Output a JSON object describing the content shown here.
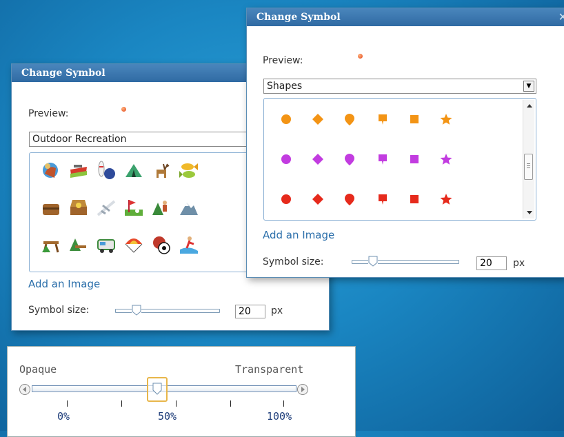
{
  "dialog_back": {
    "title": "Change Symbol",
    "preview_label": "Preview:",
    "category": "Outdoor Recreation",
    "icons": [
      "horse-rider-icon",
      "boat-icon",
      "bowling-icon",
      "tent-icon",
      "deer-icon",
      "fish-icon",
      "treasure-chest-icon",
      "open-chest-icon",
      "airplane-icon",
      "golf-icon",
      "hiker-icon",
      "mountain-icon",
      "picnic-table-icon",
      "campsite-icon",
      "rv-icon",
      "parachute-icon",
      "sports-balls-icon",
      "water-skier-icon"
    ],
    "add_image": "Add an Image",
    "size_label": "Symbol size:",
    "size_value": "20",
    "size_unit": "px"
  },
  "dialog_front": {
    "title": "Change Symbol",
    "preview_label": "Preview:",
    "category": "Shapes",
    "dropdown_arrow": "▼",
    "shape_rows": [
      {
        "color": "#f39415",
        "shapes": [
          "circle",
          "diamond",
          "pin",
          "flag",
          "square",
          "star"
        ]
      },
      {
        "color": "#c23ce0",
        "shapes": [
          "circle",
          "diamond",
          "pin",
          "flag",
          "square",
          "star"
        ]
      },
      {
        "color": "#e62a1c",
        "shapes": [
          "circle",
          "diamond",
          "pin",
          "flag",
          "square",
          "star"
        ]
      }
    ],
    "add_image": "Add an Image",
    "size_label": "Symbol size:",
    "size_value": "20",
    "size_unit": "px"
  },
  "opacity": {
    "left_label": "Opaque",
    "right_label": "Transparent",
    "ticks": [
      "0%",
      "50%",
      "100%"
    ],
    "value_percent": 50
  }
}
